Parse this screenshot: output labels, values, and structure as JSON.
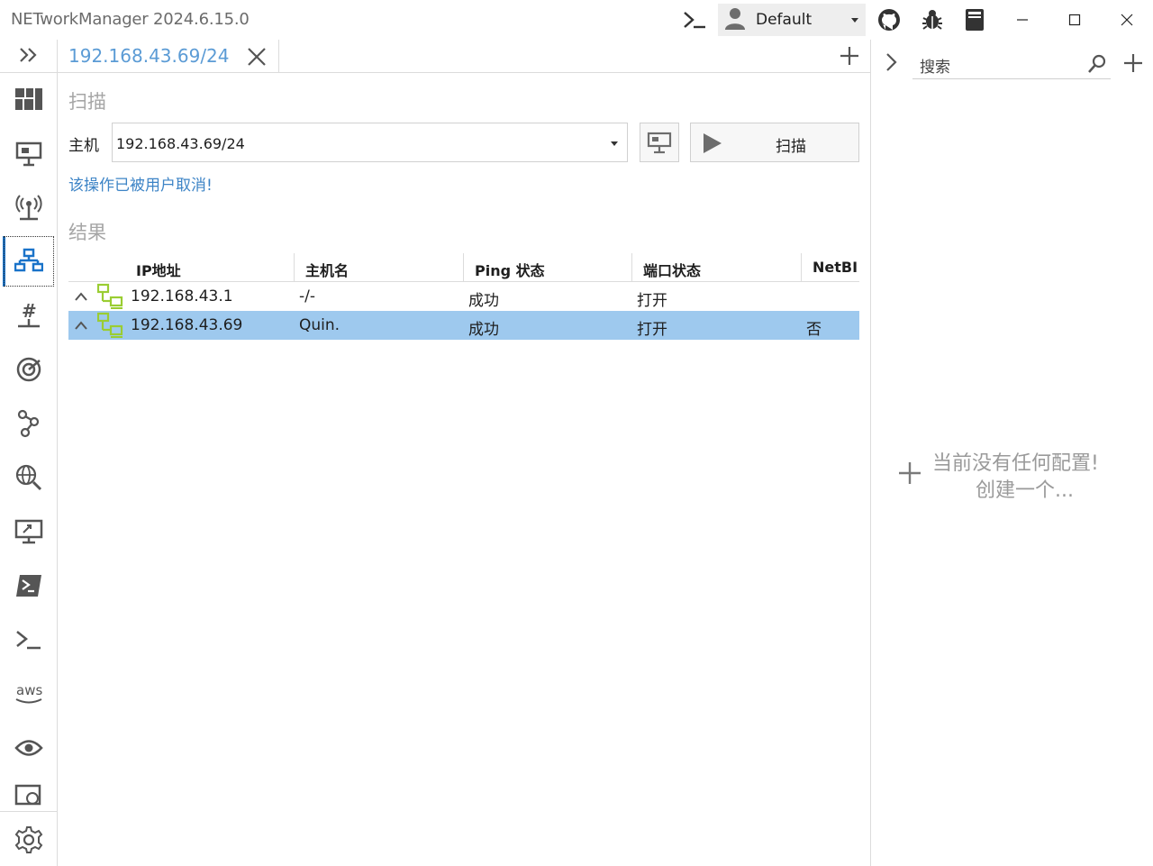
{
  "app": {
    "title": "NETworkManager 2024.6.15.0",
    "profile_label": "Default"
  },
  "colors": {
    "accent": "#1a73c9",
    "tab_text": "#5b9bd5",
    "status_text": "#3d84c6",
    "selected_row": "#9ec9ee",
    "host_icon": "#9acd32"
  },
  "nav": {
    "items": [
      "expand-icon",
      "dashboard-icon",
      "network-interface-icon",
      "wifi-icon",
      "ip-scanner-icon",
      "port-scanner-icon",
      "ping-monitor-icon",
      "traceroute-icon",
      "dns-lookup-icon",
      "remote-desktop-icon",
      "powershell-icon",
      "terminal-icon",
      "aws-icon",
      "tightvnc-icon",
      "web-console-icon",
      "settings-icon"
    ],
    "aws_label": "aws",
    "active": "ip-scanner-icon"
  },
  "tabs": [
    {
      "label": "192.168.43.69/24"
    }
  ],
  "scan": {
    "section_title": "扫描",
    "host_label": "主机",
    "host_value": "192.168.43.69/24",
    "scan_button": "扫描",
    "status_message": "该操作已被用户取消!"
  },
  "results": {
    "section_title": "结果",
    "columns": [
      "IP地址",
      "主机名",
      "Ping 状态",
      "端口状态",
      "NetBI"
    ],
    "rows": [
      {
        "ip": "192.168.43.1",
        "hostname": "-/-",
        "ping": "成功",
        "ports": "打开",
        "netbios": "",
        "selected": false
      },
      {
        "ip": "192.168.43.69",
        "hostname": "Quin.",
        "ping": "成功",
        "ports": "打开",
        "netbios": "否",
        "selected": true
      }
    ]
  },
  "profiles_panel": {
    "search_placeholder": "搜索",
    "empty_line1": "当前没有任何配置!",
    "empty_line2": "创建一个..."
  }
}
